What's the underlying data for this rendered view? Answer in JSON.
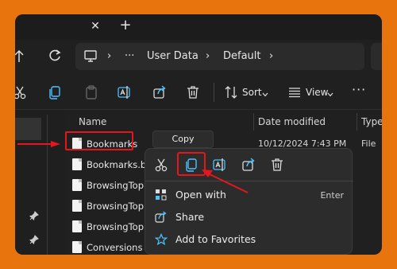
{
  "window": {
    "tab_close_glyph": "✕",
    "tab_new_glyph": "+"
  },
  "address": {
    "breadcrumbs": [
      "User Data",
      "Default"
    ],
    "ellipsis": "···",
    "separator": "›"
  },
  "toolbar": {
    "sort_label": "Sort",
    "view_label": "View",
    "more_glyph": "···",
    "icons": [
      "cut-icon",
      "copy-icon",
      "paste-icon",
      "rename-icon",
      "share-icon",
      "delete-icon"
    ]
  },
  "columns": {
    "name": "Name",
    "date_modified": "Date modified",
    "type": "Type"
  },
  "files": [
    {
      "name": "Bookmarks",
      "date": "10/12/2024 7:43 PM",
      "type": "File"
    },
    {
      "name": "Bookmarks.bak",
      "date": "",
      "type": ""
    },
    {
      "name": "BrowsingTopics",
      "date": "",
      "type": ""
    },
    {
      "name": "BrowsingTopics",
      "date": "",
      "type": ""
    },
    {
      "name": "BrowsingTopics",
      "date": "",
      "type": ""
    },
    {
      "name": "Conversions",
      "date": "",
      "type": ""
    }
  ],
  "tooltip": {
    "text": "Copy (Ctrl+C)"
  },
  "context_menu": {
    "quick_actions": [
      "cut-icon",
      "copy-icon",
      "rename-icon",
      "share-icon",
      "delete-icon"
    ],
    "items": [
      {
        "label": "Open with",
        "shortcut": "Enter"
      },
      {
        "label": "Share",
        "shortcut": ""
      },
      {
        "label": "Add to Favorites",
        "shortcut": ""
      }
    ]
  },
  "colors": {
    "frame": "#e8740e",
    "annotation": "#e3171c",
    "window_bg": "#202020",
    "menu_bg": "#2c2c2c",
    "accent_icon": "#4cc2ff"
  }
}
